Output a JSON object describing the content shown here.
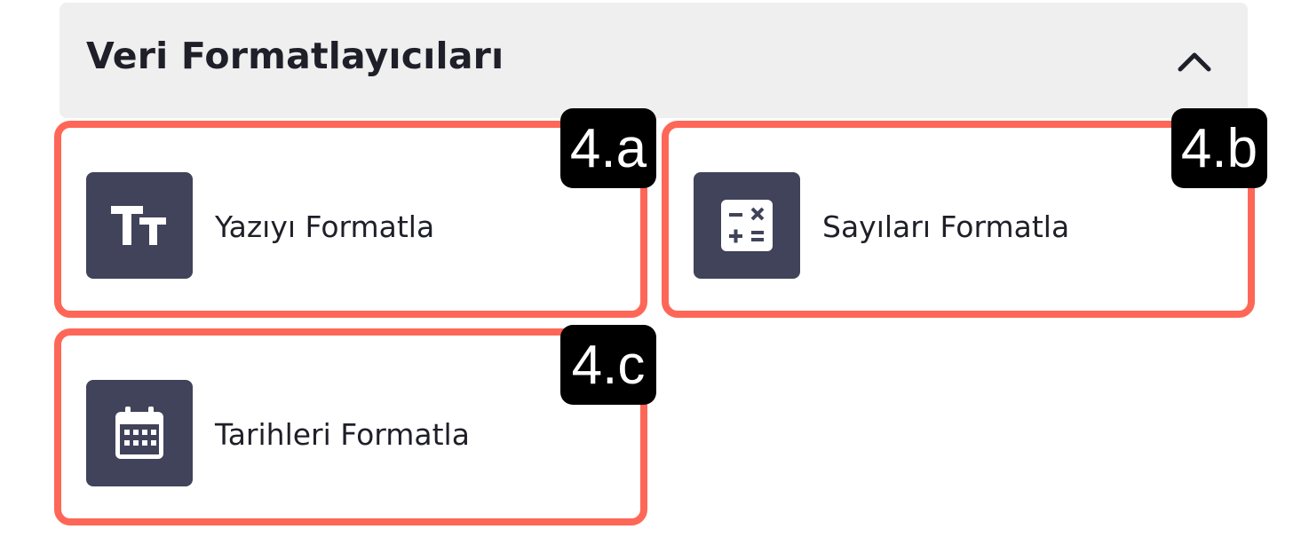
{
  "section": {
    "title": "Veri Formatlayıcıları",
    "collapse_icon": "chevron-up-icon"
  },
  "cards": [
    {
      "label": "Yazıyı Formatla",
      "icon": "text-size-icon",
      "badge": "4.a"
    },
    {
      "label": "Sayıları Formatla",
      "icon": "calculator-icon",
      "badge": "4.b"
    },
    {
      "label": "Tarihleri Formatla",
      "icon": "calendar-icon",
      "badge": "4.c"
    }
  ],
  "colors": {
    "highlight_border": "#fe6757",
    "icon_tile": "#40435a",
    "header_bg": "#efefef",
    "badge_bg": "#000000"
  }
}
